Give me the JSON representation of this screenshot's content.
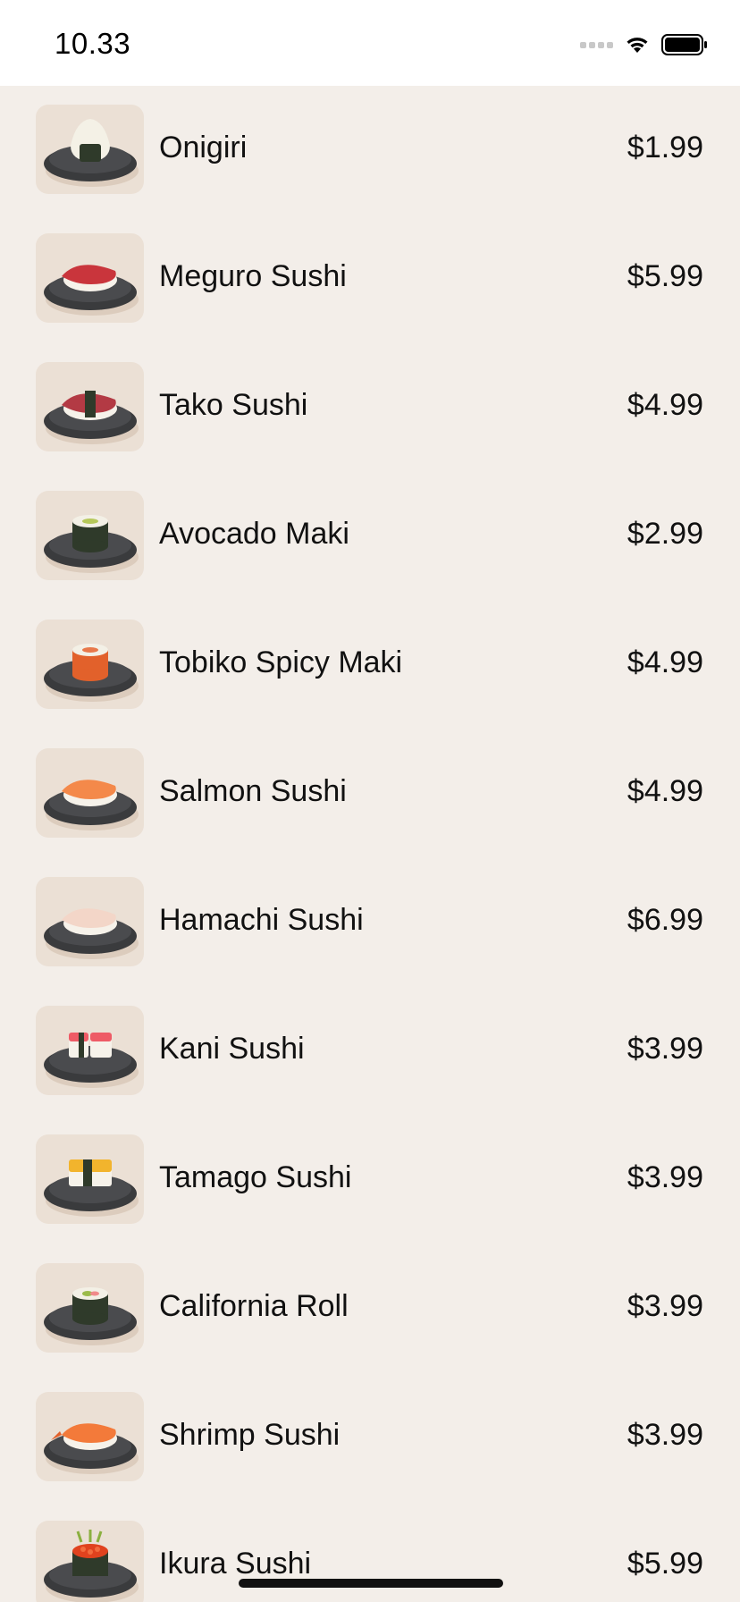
{
  "status_bar": {
    "time": "10.33",
    "icons": [
      "signal-icon",
      "wifi-icon",
      "battery-icon"
    ]
  },
  "menu": {
    "items": [
      {
        "name": "Onigiri",
        "price": "$1.99",
        "icon": "onigiri-icon"
      },
      {
        "name": "Meguro Sushi",
        "price": "$5.99",
        "icon": "meguro-sushi-icon"
      },
      {
        "name": "Tako Sushi",
        "price": "$4.99",
        "icon": "tako-sushi-icon"
      },
      {
        "name": "Avocado Maki",
        "price": "$2.99",
        "icon": "avocado-maki-icon"
      },
      {
        "name": "Tobiko Spicy Maki",
        "price": "$4.99",
        "icon": "tobiko-maki-icon"
      },
      {
        "name": "Salmon Sushi",
        "price": "$4.99",
        "icon": "salmon-sushi-icon"
      },
      {
        "name": "Hamachi Sushi",
        "price": "$6.99",
        "icon": "hamachi-sushi-icon"
      },
      {
        "name": "Kani Sushi",
        "price": "$3.99",
        "icon": "kani-sushi-icon"
      },
      {
        "name": "Tamago Sushi",
        "price": "$3.99",
        "icon": "tamago-sushi-icon"
      },
      {
        "name": "California Roll",
        "price": "$3.99",
        "icon": "california-roll-icon"
      },
      {
        "name": "Shrimp Sushi",
        "price": "$3.99",
        "icon": "shrimp-sushi-icon"
      },
      {
        "name": "Ikura Sushi",
        "price": "$5.99",
        "icon": "ikura-sushi-icon"
      }
    ]
  },
  "colors": {
    "background": "#f3eee9",
    "thumb_background": "#ebe0d5",
    "status_bar": "#ffffff"
  }
}
